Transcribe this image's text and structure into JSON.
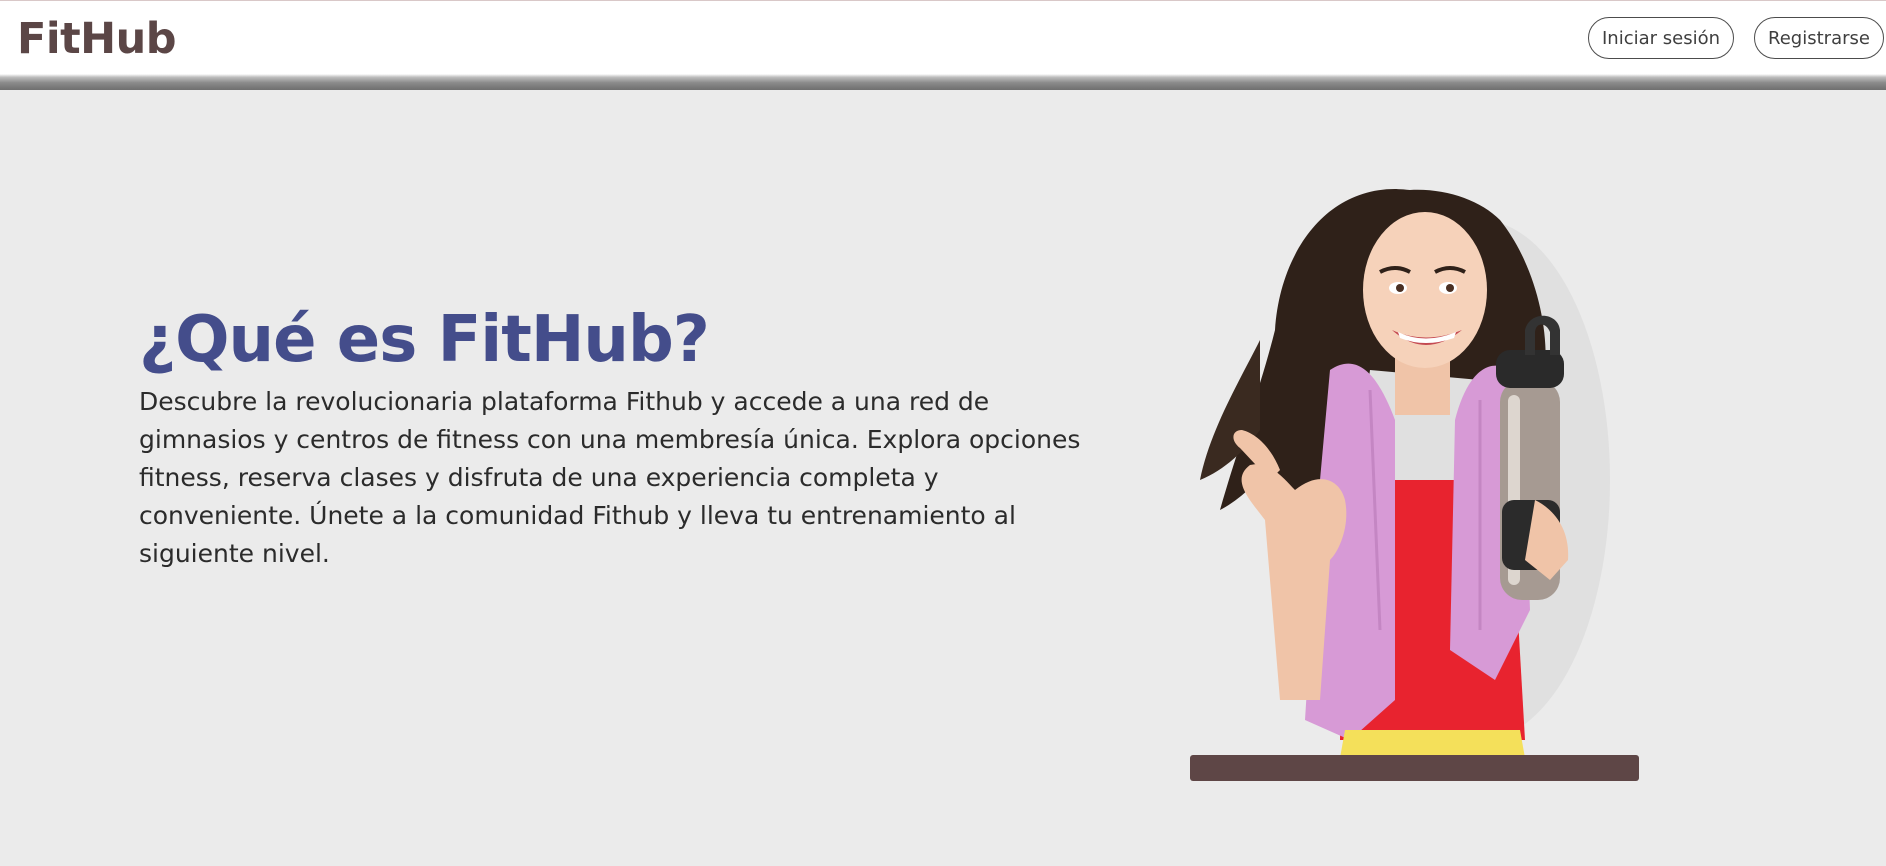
{
  "header": {
    "logo": "FitHub",
    "login_label": "Iniciar sesión",
    "register_label": "Registrarse"
  },
  "hero": {
    "title": "¿Qué es FitHub?",
    "description": "Descubre la revolucionaria plataforma Fithub y accede a una red de gimnasios y centros de fitness con una membresía única. Explora opciones fitness, reserva clases y disfruta de una experiencia completa y conveniente. Únete a la comunidad Fithub y lleva tu entrenamiento al siguiente nivel.",
    "image_icon": "woman-fitness-photo"
  },
  "colors": {
    "brand": "#5b4646",
    "title": "#444d8b",
    "background": "#ebebeb",
    "pedestal": "#5e4646"
  }
}
